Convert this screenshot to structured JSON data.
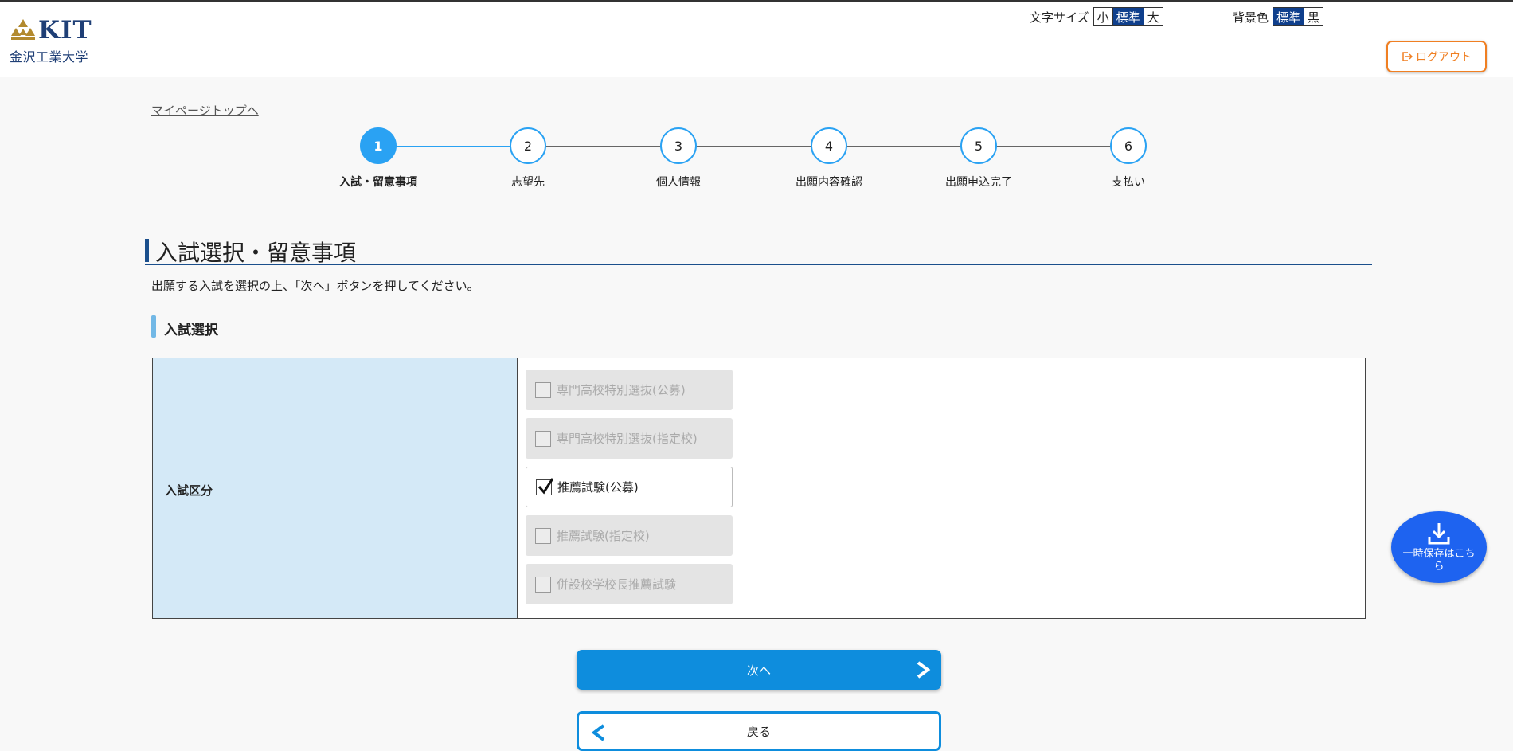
{
  "header": {
    "logo_text": "KIT",
    "logo_subtext": "金沢工業大学",
    "font_size": {
      "label": "文字サイズ",
      "options": [
        "小",
        "標準",
        "大"
      ],
      "selected": "標準"
    },
    "background": {
      "label": "背景色",
      "options": [
        "標準",
        "黒"
      ],
      "selected": "標準"
    },
    "logout_label": "ログアウト"
  },
  "mypage_link": "マイページトップへ",
  "steps": [
    {
      "number": "1",
      "label": "入試・留意事項",
      "active": true
    },
    {
      "number": "2",
      "label": "志望先",
      "active": false
    },
    {
      "number": "3",
      "label": "個人情報",
      "active": false
    },
    {
      "number": "4",
      "label": "出願内容確認",
      "active": false
    },
    {
      "number": "5",
      "label": "出願申込完了",
      "active": false
    },
    {
      "number": "6",
      "label": "支払い",
      "active": false
    }
  ],
  "page_title": "入試選択・留意事項",
  "intro_text": "出願する入試を選択の上、「次へ」ボタンを押してください。",
  "section_title": "入試選択",
  "form": {
    "row_label": "入試区分",
    "options": [
      {
        "label": "専門高校特別選抜(公募)",
        "enabled": false,
        "checked": false
      },
      {
        "label": "専門高校特別選抜(指定校)",
        "enabled": false,
        "checked": false
      },
      {
        "label": "推薦試験(公募)",
        "enabled": true,
        "checked": true
      },
      {
        "label": "推薦試験(指定校)",
        "enabled": false,
        "checked": false
      },
      {
        "label": "併設校学校長推薦試験",
        "enabled": false,
        "checked": false
      }
    ]
  },
  "buttons": {
    "next_label": "次へ",
    "back_label": "戻る"
  },
  "save_button_label": "一時保存はこちら",
  "colors": {
    "primary": "#0e8ddd",
    "step_accent": "#2aa2f3",
    "logout": "#f07f22",
    "save": "#1e63f0",
    "brand": "#1f3f76"
  }
}
